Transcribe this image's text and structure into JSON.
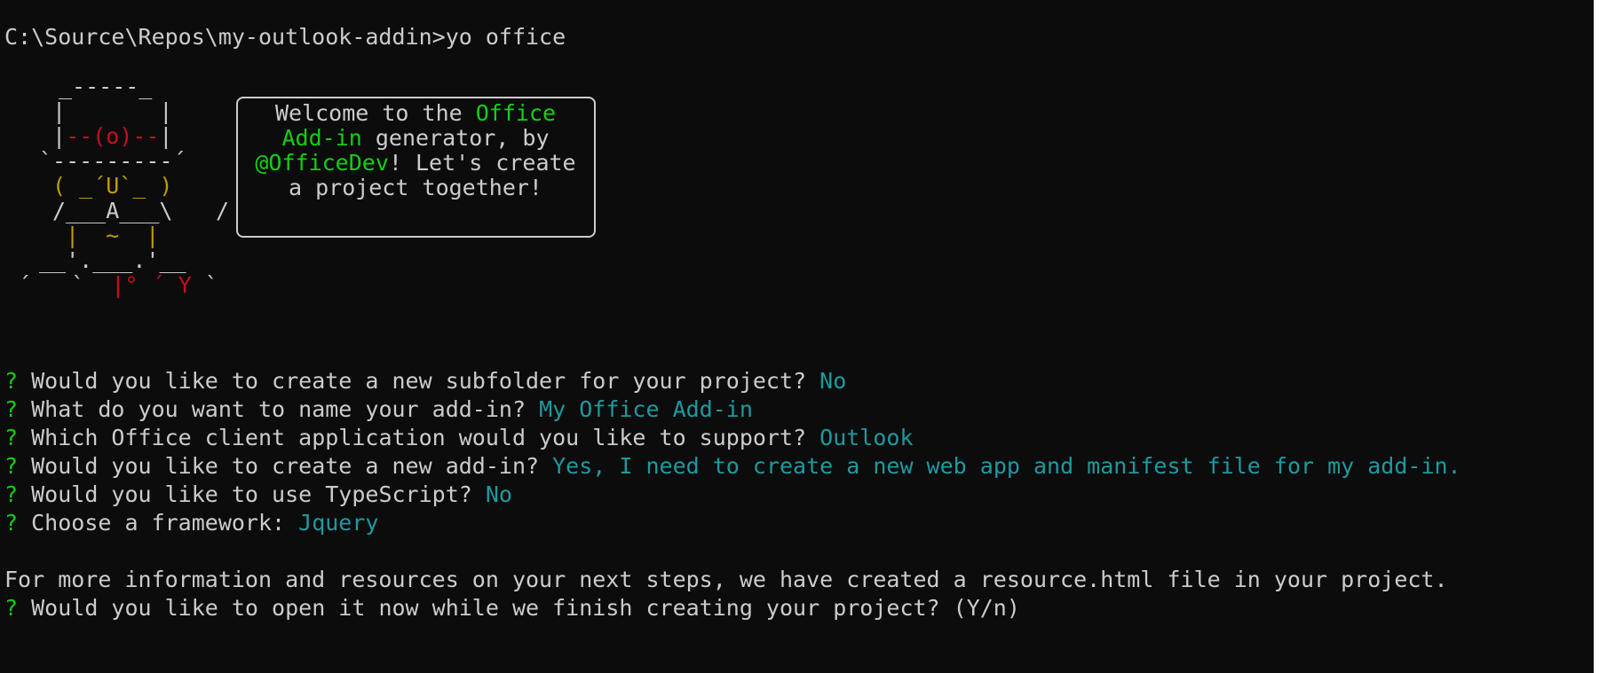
{
  "prompt_line": {
    "path": "C:\\Source\\Repos\\my-outlook-addin>",
    "command": "yo office"
  },
  "ascii_art": {
    "hat_top": "_-----_",
    "head_side": "|       |",
    "eye_left": "|",
    "eye_mid": "--(o)--",
    "eye_right": "|",
    "brim": "`---------´",
    "face": "( _´U`_ )",
    "arms": "/___A___\\",
    "pointer": "/",
    "body": "|  ~  |",
    "legs": "__'.___.'__",
    "feet_left": "´   `",
    "feet_mid": "|°",
    "feet_y": "´ Y",
    "feet_right": "`"
  },
  "welcome": {
    "l1_a": "Welcome to the ",
    "l1_b": "Office",
    "l2_a": "Add-in",
    "l2_b": " generator, by",
    "l3_a": "@OfficeDev",
    "l3_b": "! Let's create",
    "l4": "a project together!"
  },
  "questions": [
    {
      "mark": "?",
      "text": " Would you like to create a new subfolder for your project? ",
      "answer": "No"
    },
    {
      "mark": "?",
      "text": " What do you want to name your add-in? ",
      "answer": "My Office Add-in"
    },
    {
      "mark": "?",
      "text": " Which Office client application would you like to support? ",
      "answer": "Outlook"
    },
    {
      "mark": "?",
      "text": " Would you like to create a new add-in? ",
      "answer": "Yes, I need to create a new web app and manifest file for my add-in."
    },
    {
      "mark": "?",
      "text": " Would you like to use TypeScript? ",
      "answer": "No"
    },
    {
      "mark": "?",
      "text": " Choose a framework: ",
      "answer": "Jquery"
    }
  ],
  "info_line": "For more information and resources on your next steps, we have created a resource.html file in your project.",
  "final_question": {
    "mark": "?",
    "text": " Would you like to open it now while we finish creating your project? (Y/n)"
  },
  "colors": {
    "background": "#0c0c0c",
    "text": "#cccccc",
    "green": "#13d013",
    "cyan": "#1d9aa0",
    "red": "#c50f1f",
    "yellow": "#c19c00"
  }
}
